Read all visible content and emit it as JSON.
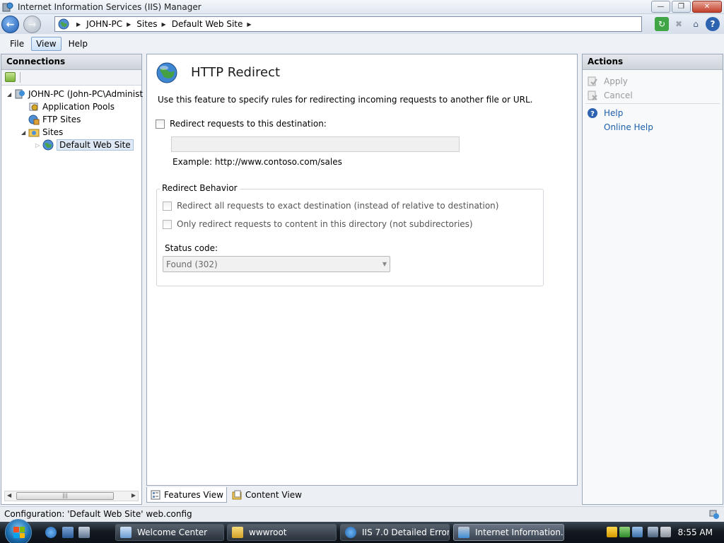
{
  "window": {
    "title": "Internet Information Services (IIS) Manager"
  },
  "address": {
    "crumbs": [
      "JOHN-PC",
      "Sites",
      "Default Web Site"
    ]
  },
  "menu": {
    "file": "File",
    "view": "View",
    "help": "Help"
  },
  "connections": {
    "header": "Connections",
    "tree": {
      "server": "JOHN-PC (John-PC\\Administ",
      "app_pools": "Application Pools",
      "ftp_sites": "FTP Sites",
      "sites": "Sites",
      "default_site": "Default Web Site"
    }
  },
  "feature": {
    "title": "HTTP Redirect",
    "description": "Use this feature to specify rules for redirecting incoming requests to another file or URL.",
    "redirect_checkbox_label": "Redirect requests to this destination:",
    "redirect_checked": false,
    "destination_value": "",
    "example": "Example: http://www.contoso.com/sales",
    "behavior_group": "Redirect Behavior",
    "exact_destination_label": "Redirect all requests to exact destination (instead of relative to destination)",
    "this_directory_label": "Only redirect requests to content in this directory (not subdirectories)",
    "status_code_label": "Status code:",
    "status_code_value": "Found (302)"
  },
  "view_tabs": {
    "features": "Features View",
    "content": "Content View"
  },
  "actions": {
    "header": "Actions",
    "apply": "Apply",
    "cancel": "Cancel",
    "help": "Help",
    "online_help": "Online Help"
  },
  "statusbar": {
    "text": "Configuration: 'Default Web Site' web.config"
  },
  "taskbar": {
    "tasks": [
      "Welcome Center",
      "wwwroot",
      "IIS 7.0 Detailed Error ...",
      "Internet Information..."
    ],
    "clock": "8:55 AM"
  },
  "colors": {
    "accent": "#1c5fa8",
    "taskbar": "#141a21",
    "selection": "#dfe9f5"
  }
}
